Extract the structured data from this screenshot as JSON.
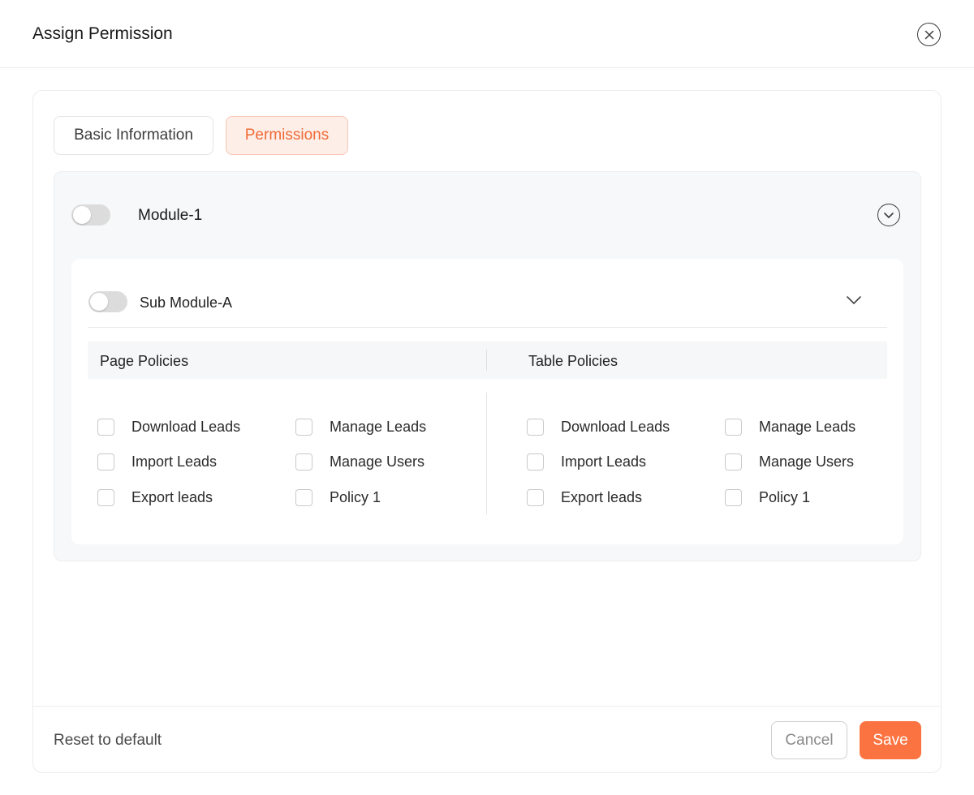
{
  "dialog": {
    "title": "Assign Permission",
    "close_icon": "close-icon"
  },
  "tabs": [
    {
      "label": "Basic Information",
      "active": false
    },
    {
      "label": "Permissions",
      "active": true
    }
  ],
  "module": {
    "title": "Module-1",
    "enabled": false,
    "expand_icon": "chevron-down-circle-icon",
    "submodule": {
      "title": "Sub Module-A",
      "enabled": false,
      "expand_icon": "chevron-down-icon",
      "page_policies": {
        "label": "Page Policies",
        "items": [
          {
            "label": "Download Leads",
            "checked": false
          },
          {
            "label": "Manage Leads",
            "checked": false
          },
          {
            "label": "Import Leads",
            "checked": false
          },
          {
            "label": "Manage Users",
            "checked": false
          },
          {
            "label": "Export leads",
            "checked": false
          },
          {
            "label": "Policy 1",
            "checked": false
          }
        ]
      },
      "table_policies": {
        "label": "Table Policies",
        "items": [
          {
            "label": "Download Leads",
            "checked": false
          },
          {
            "label": "Manage Leads",
            "checked": false
          },
          {
            "label": "Import Leads",
            "checked": false
          },
          {
            "label": "Manage Users",
            "checked": false
          },
          {
            "label": "Export leads",
            "checked": false
          },
          {
            "label": "Policy 1",
            "checked": false
          }
        ]
      }
    }
  },
  "footer": {
    "reset_label": "Reset to default",
    "cancel_label": "Cancel",
    "save_label": "Save"
  },
  "colors": {
    "accent": "#fb7340",
    "tab_active_bg": "#fdeee8",
    "tab_active_text": "#f06a36"
  }
}
